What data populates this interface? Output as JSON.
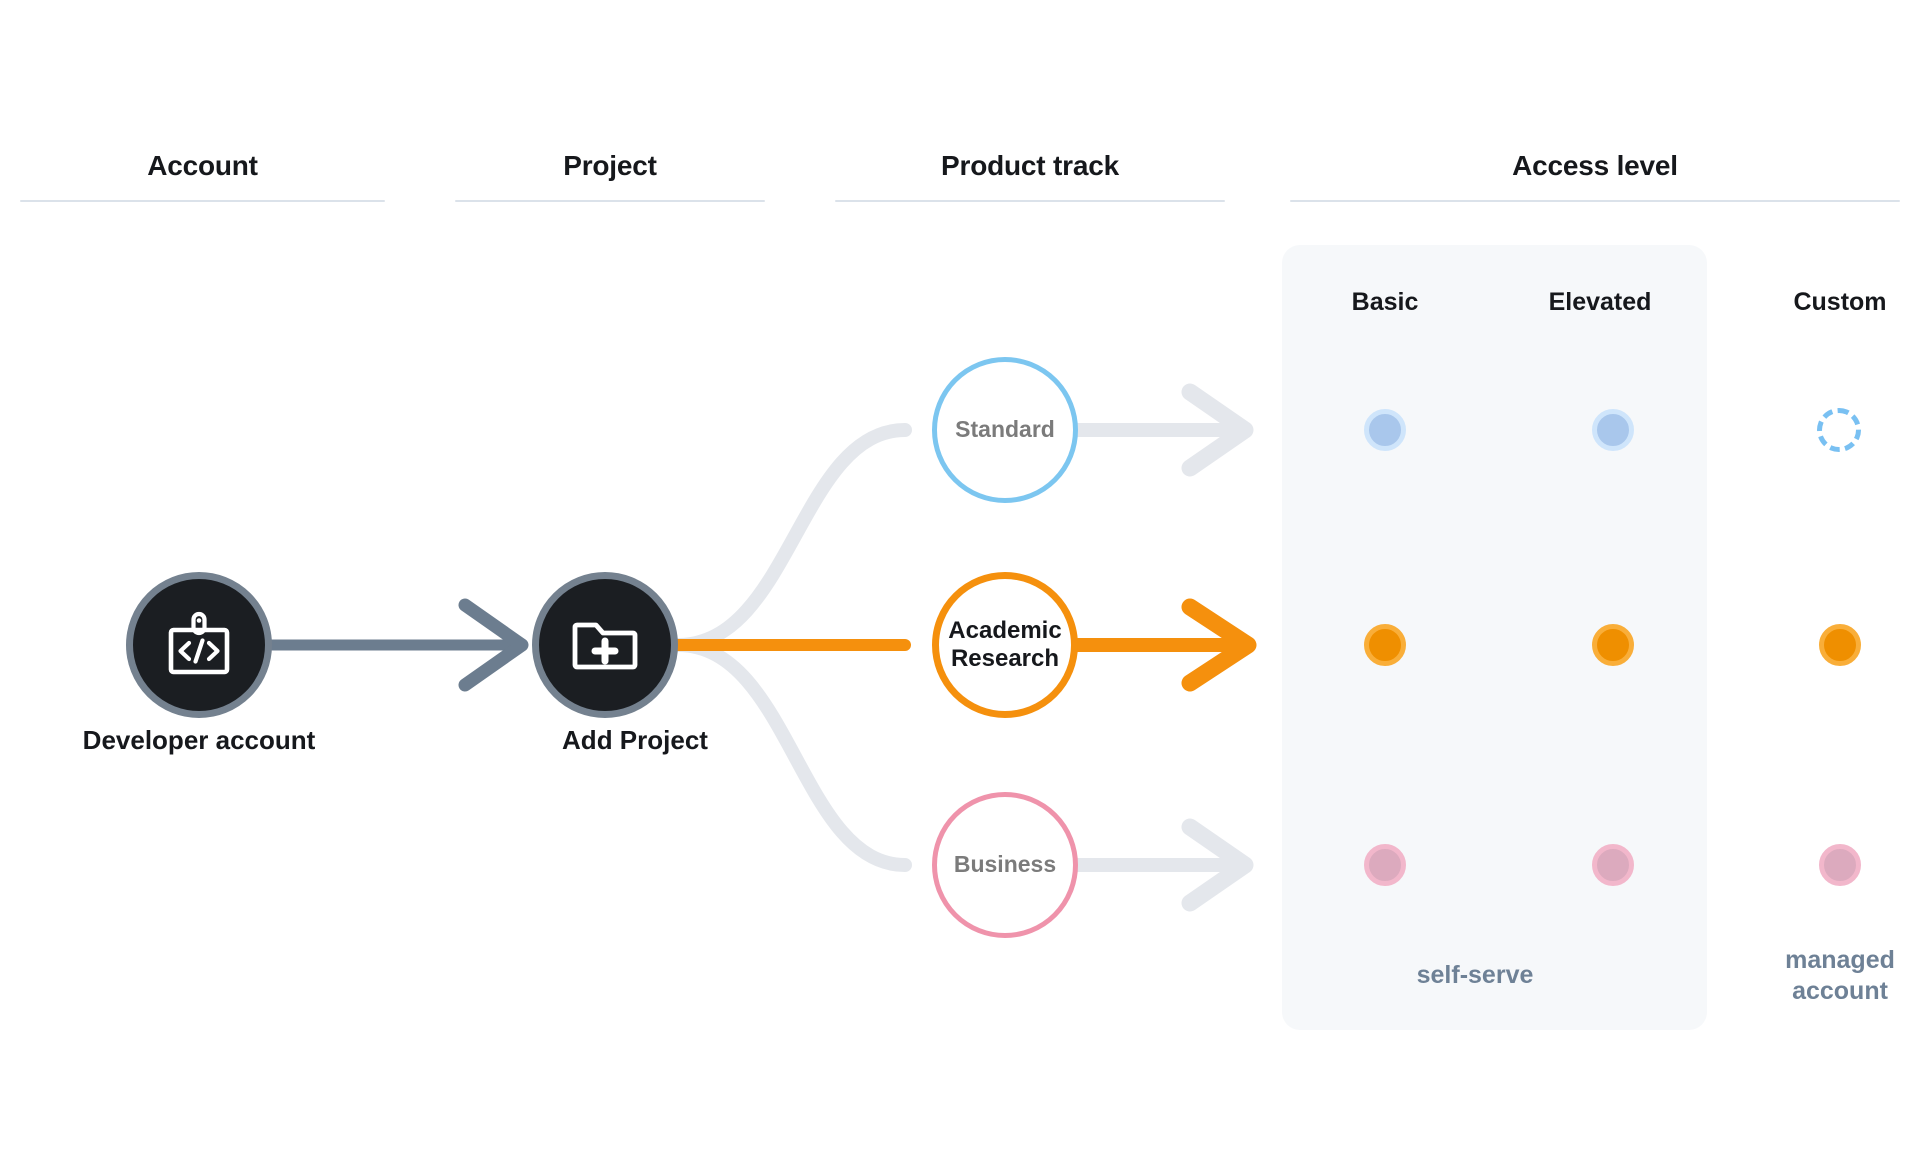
{
  "columns": [
    {
      "id": "account",
      "title": "Account"
    },
    {
      "id": "project",
      "title": "Project"
    },
    {
      "id": "track",
      "title": "Product track"
    },
    {
      "id": "access",
      "title": "Access level"
    }
  ],
  "nodes": {
    "developer_account": {
      "label": "Developer account",
      "icon": "id-badge-code-icon"
    },
    "add_project": {
      "label": "Add Project",
      "icon": "folder-plus-icon"
    }
  },
  "product_tracks": [
    {
      "id": "standard",
      "label": "Standard",
      "color": "#7cc6f0",
      "active": false
    },
    {
      "id": "academic",
      "label": "Academic\nResearch",
      "color": "#f5900d",
      "active": true
    },
    {
      "id": "business",
      "label": "Business",
      "color": "#ef93ab",
      "active": false
    }
  ],
  "product_track_labels": {
    "standard": "Standard",
    "academic_line1": "Academic",
    "academic_line2": "Research",
    "business": "Business"
  },
  "access_levels": {
    "columns": [
      {
        "id": "basic",
        "label": "Basic",
        "in_panel": true
      },
      {
        "id": "elevated",
        "label": "Elevated",
        "in_panel": true
      },
      {
        "id": "custom",
        "label": "Custom",
        "in_panel": false
      }
    ],
    "rows": [
      {
        "track": "standard",
        "color": "#a9c7ec",
        "ring": "#cfe5fb",
        "states": [
          "filled",
          "filled",
          "dashed"
        ]
      },
      {
        "track": "academic",
        "color": "#ef8f00",
        "ring": "#f9ae39",
        "states": [
          "filled",
          "filled",
          "filled"
        ]
      },
      {
        "track": "business",
        "color": "#dcaabe",
        "ring": "#f2b7cb",
        "states": [
          "filled",
          "filled",
          "filled"
        ]
      }
    ],
    "footers": {
      "self_serve": "self-serve",
      "managed_line1": "managed",
      "managed_line2": "account"
    }
  },
  "colors": {
    "panel_bg": "#f6f8fa",
    "rule": "#dbe2ea",
    "arrow_slate": "#6c7d8f",
    "arrow_muted": "#e4e7ec",
    "accent_orange": "#f5900d",
    "node_dark": "#1b1e22",
    "node_ring": "#74818f",
    "muted_text": "#6e8196"
  }
}
